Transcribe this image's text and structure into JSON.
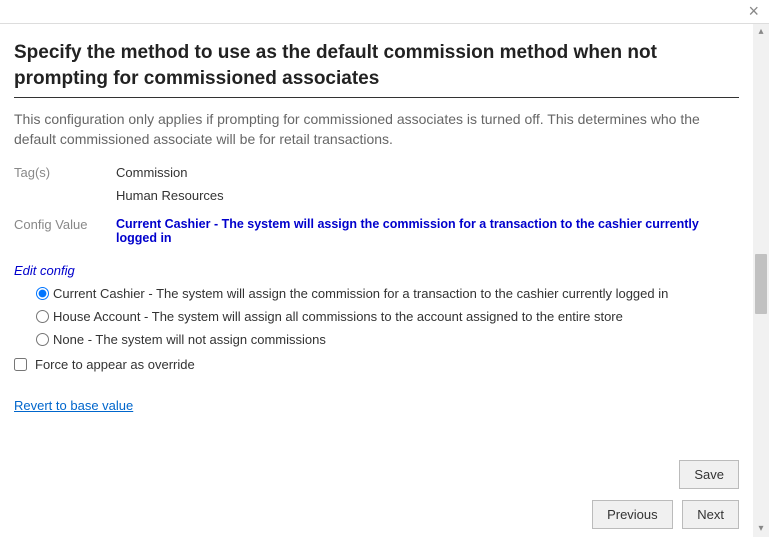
{
  "close_label": "×",
  "title": "Specify the method to use as the default commission method when not prompting for commissioned associates",
  "description": "This configuration only applies if prompting for commissioned associates is turned off. This determines who the default commissioned associate will be for retail transactions.",
  "tags_label": "Tag(s)",
  "tags": [
    "Commission",
    "Human Resources"
  ],
  "config_value_label": "Config Value",
  "config_value": "Current Cashier - The system will assign the commission for a transaction to the cashier currently logged in",
  "edit_header": "Edit config",
  "options": [
    {
      "label": "Current Cashier - The system will assign the commission for a transaction to the cashier currently logged in",
      "selected": true
    },
    {
      "label": "House Account - The system will assign all commissions to the account assigned to the entire store",
      "selected": false
    },
    {
      "label": "None - The system will not assign commissions",
      "selected": false
    }
  ],
  "force_override_label": "Force to appear as override",
  "force_override_checked": false,
  "revert_label": "Revert to base value",
  "buttons": {
    "save": "Save",
    "previous": "Previous",
    "next": "Next"
  }
}
